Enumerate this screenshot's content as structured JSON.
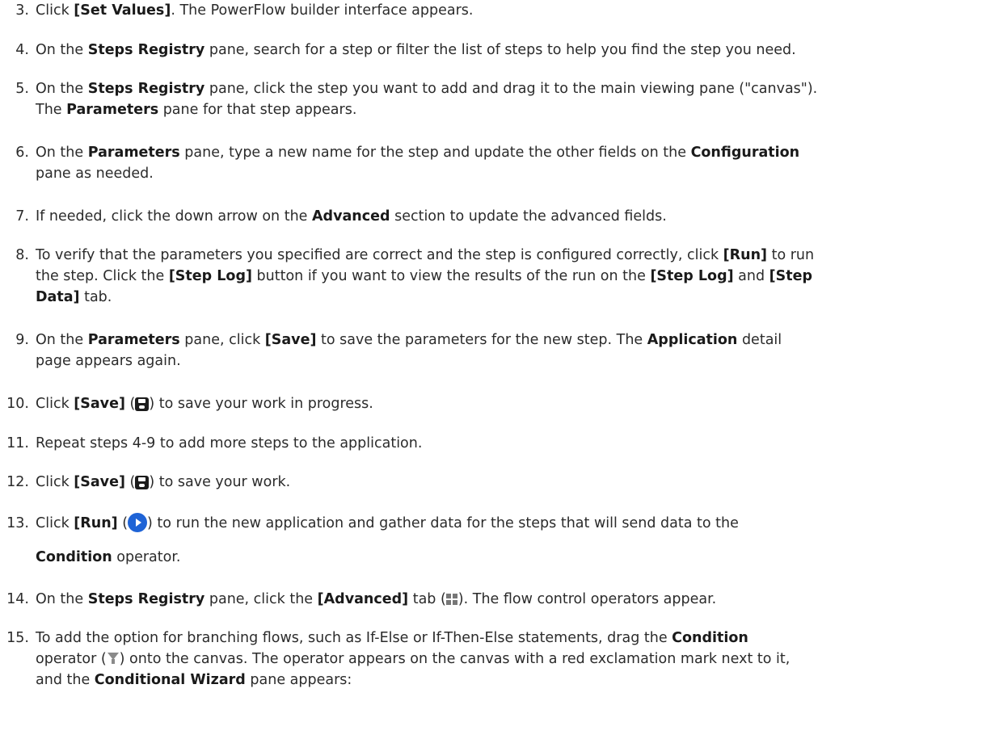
{
  "steps": [
    {
      "n": "3.",
      "parts": [
        {
          "t": "Click "
        },
        {
          "t": "[Set Values]",
          "b": true
        },
        {
          "t": ". The PowerFlow builder interface appears."
        }
      ]
    },
    {
      "n": "4.",
      "parts": [
        {
          "t": "On the "
        },
        {
          "t": "Steps Registry",
          "b": true
        },
        {
          "t": " pane, search for a step or filter the list of steps to help you find the step you need."
        }
      ]
    },
    {
      "n": "5.",
      "parts": [
        {
          "t": "On the "
        },
        {
          "t": "Steps Registry",
          "b": true
        },
        {
          "t": " pane, click the step you want to add and drag it to the main viewing pane (\"canvas\")."
        },
        {
          "br": true
        },
        {
          "t": "The "
        },
        {
          "t": "Parameters",
          "b": true
        },
        {
          "t": " pane for that step appears."
        }
      ]
    },
    {
      "n": "6.",
      "parts": [
        {
          "t": "On the "
        },
        {
          "t": "Parameters",
          "b": true
        },
        {
          "t": " pane, type a new name for the step and update the other fields on the "
        },
        {
          "t": "Configuration",
          "b": true
        },
        {
          "br": true
        },
        {
          "t": "pane as needed."
        }
      ]
    },
    {
      "n": "7.",
      "parts": [
        {
          "t": "If needed, click the down arrow on the "
        },
        {
          "t": "Advanced",
          "b": true
        },
        {
          "t": " section to update the advanced fields."
        }
      ]
    },
    {
      "n": "8.",
      "parts": [
        {
          "t": "To verify that the parameters you specified are correct and the step is configured correctly, click "
        },
        {
          "t": "[Run]",
          "b": true
        },
        {
          "t": " to run"
        },
        {
          "br": true
        },
        {
          "t": "the step. Click the "
        },
        {
          "t": "[Step Log]",
          "b": true
        },
        {
          "t": " button if you want to view the results of the run on the "
        },
        {
          "t": "[Step Log]",
          "b": true
        },
        {
          "t": " and "
        },
        {
          "t": "[Step",
          "b": true
        },
        {
          "br": true
        },
        {
          "t": "Data]",
          "b": true
        },
        {
          "t": " tab."
        }
      ]
    },
    {
      "n": "9.",
      "parts": [
        {
          "t": "On the "
        },
        {
          "t": "Parameters",
          "b": true
        },
        {
          "t": " pane, click "
        },
        {
          "t": "[Save]",
          "b": true
        },
        {
          "t": " to save the parameters for the new step. The "
        },
        {
          "t": "Application",
          "b": true
        },
        {
          "t": " detail"
        },
        {
          "br": true
        },
        {
          "t": "page appears again."
        }
      ]
    },
    {
      "n": "10.",
      "parts": [
        {
          "t": "Click "
        },
        {
          "t": "[Save]",
          "b": true
        },
        {
          "t": " ("
        },
        {
          "icon": "save-icon"
        },
        {
          "t": ") to save your work in progress."
        }
      ]
    },
    {
      "n": "11.",
      "parts": [
        {
          "t": "Repeat steps 4-9 to add more steps to the application."
        }
      ]
    },
    {
      "n": "12.",
      "parts": [
        {
          "t": "Click "
        },
        {
          "t": "[Save]",
          "b": true
        },
        {
          "t": " ("
        },
        {
          "icon": "save-icon"
        },
        {
          "t": ") to save your work."
        }
      ]
    },
    {
      "n": "13.",
      "parts": [
        {
          "t": "Click "
        },
        {
          "t": "[Run]",
          "b": true
        },
        {
          "t": " ("
        },
        {
          "icon": "run-icon"
        },
        {
          "t": ") to run the new application and gather data for the steps that will send data to the"
        },
        {
          "br": true,
          "gap": true
        },
        {
          "t": "Condition",
          "b": true
        },
        {
          "t": " operator."
        }
      ]
    },
    {
      "n": "14.",
      "parts": [
        {
          "t": "On the "
        },
        {
          "t": "Steps Registry",
          "b": true
        },
        {
          "t": " pane, click the "
        },
        {
          "t": "[Advanced]",
          "b": true
        },
        {
          "t": " tab ("
        },
        {
          "icon": "advanced-tab-icon"
        },
        {
          "t": "). The flow control operators appear."
        }
      ]
    },
    {
      "n": "15.",
      "parts": [
        {
          "t": "To add the option for branching flows, such as If-Else or If-Then-Else statements, drag the "
        },
        {
          "t": "Condition",
          "b": true
        },
        {
          "br": true
        },
        {
          "t": "operator ("
        },
        {
          "icon": "filter-icon"
        },
        {
          "t": ") onto the canvas. The operator appears on the canvas with a red exclamation mark next to it,"
        },
        {
          "br": true
        },
        {
          "t": "and the "
        },
        {
          "t": "Conditional Wizard",
          "b": true
        },
        {
          "t": " pane appears:"
        }
      ]
    }
  ]
}
